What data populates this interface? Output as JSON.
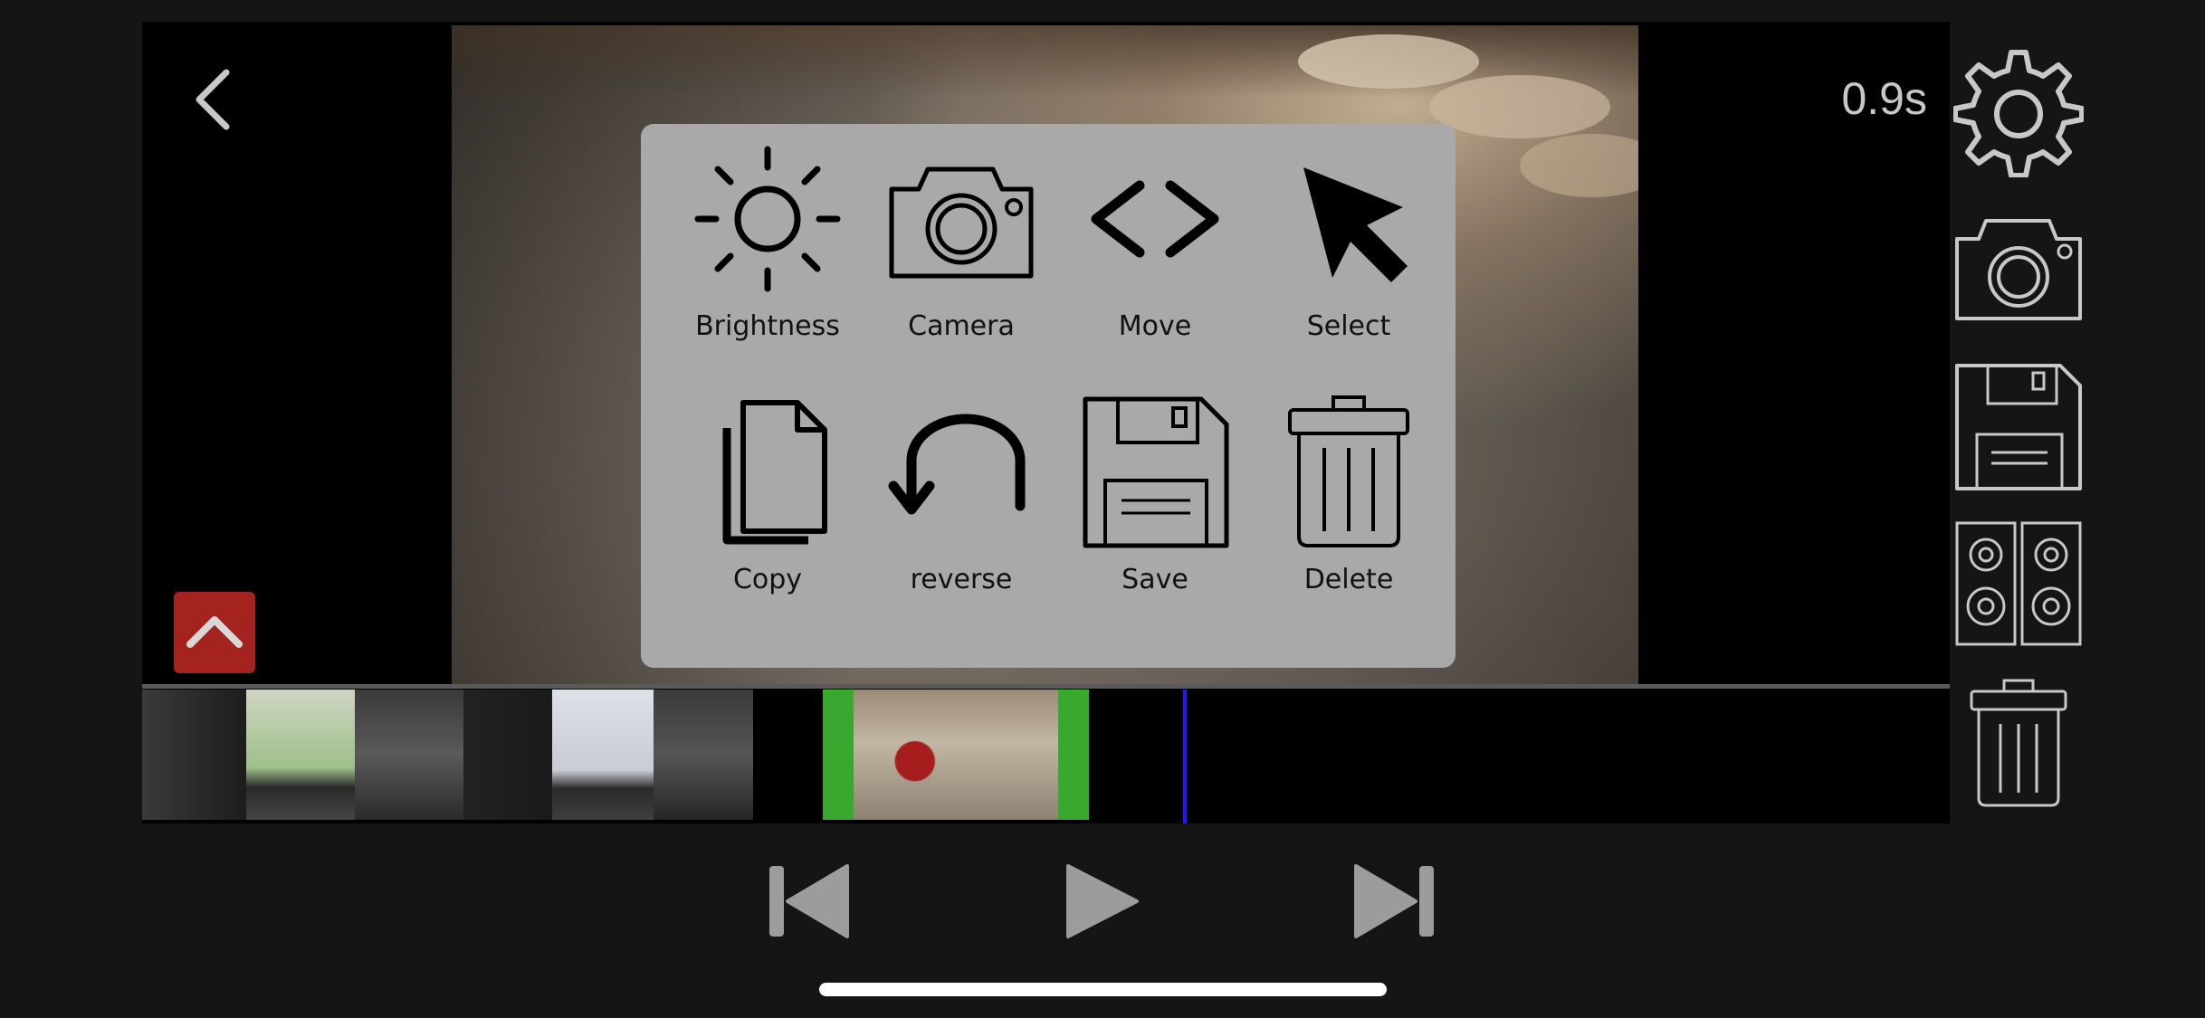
{
  "header": {
    "duration": "0.9s"
  },
  "menu": {
    "items": [
      {
        "label": "Brightness",
        "icon": "sun-icon"
      },
      {
        "label": "Camera",
        "icon": "camera-icon"
      },
      {
        "label": "Move",
        "icon": "move-arrows-icon"
      },
      {
        "label": "Select",
        "icon": "cursor-icon"
      },
      {
        "label": "Copy",
        "icon": "copy-icon"
      },
      {
        "label": "reverse",
        "icon": "reverse-arrow-icon"
      },
      {
        "label": "Save",
        "icon": "floppy-disk-icon"
      },
      {
        "label": "Delete",
        "icon": "trash-icon"
      }
    ]
  },
  "toolbar": {
    "items": [
      "gear-icon",
      "camera-icon",
      "floppy-disk-icon",
      "speakers-icon",
      "trash-icon"
    ]
  },
  "transport": {
    "items": [
      "skip-back-icon",
      "play-icon",
      "skip-forward-icon"
    ]
  },
  "colors": {
    "background": "#151515",
    "menu_background": "#a9a9a9",
    "expand_button": "#a4231f",
    "clip_selection": "#3aa82f",
    "playhead": "#1a1aff"
  }
}
